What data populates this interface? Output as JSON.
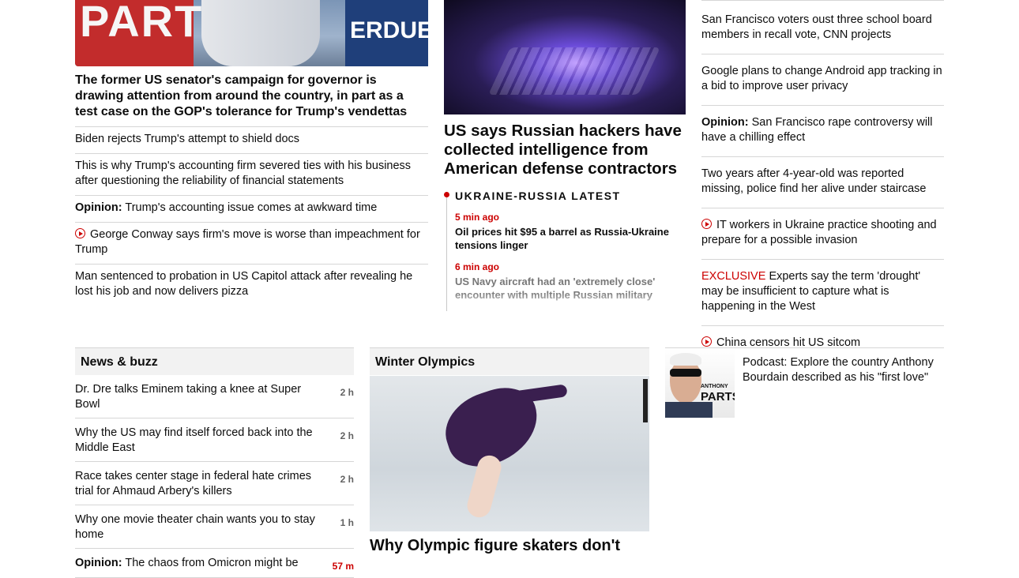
{
  "col1": {
    "photo_banner_left": "PART",
    "photo_banner_right": "ERDUE",
    "feature_headline": "The former US senator's campaign for governor is drawing attention from around the country, in part as a test case on the GOP's tolerance for Trump's vendettas",
    "links": [
      {
        "text": "Biden rejects Trump's attempt to shield docs"
      },
      {
        "text": "This is why Trump's accounting firm severed ties with his business after questioning the reliability of financial statements"
      },
      {
        "label": "Opinion:",
        "text": "Trump's accounting issue comes at awkward time"
      },
      {
        "video": true,
        "text": "George Conway says firm's move is worse than impeachment for Trump"
      },
      {
        "text": "Man sentenced to probation in US Capitol attack after revealing he lost his job and now delivers pizza"
      }
    ]
  },
  "col2": {
    "headline": "US says Russian hackers have collected intelligence from American defense contractors",
    "live_title": "UKRAINE-RUSSIA LATEST",
    "updates": [
      {
        "time": "5 min ago",
        "text": "Oil prices hit $95 a barrel as Russia-Ukraine tensions linger"
      },
      {
        "time": "6 min ago",
        "text": "US Navy aircraft had an 'extremely close' encounter with multiple Russian military"
      }
    ]
  },
  "col3": {
    "links": [
      {
        "text": "San Francisco voters oust three school board members in recall vote, CNN projects"
      },
      {
        "text": "Google plans to change Android app tracking in a bid to improve user privacy"
      },
      {
        "label": "Opinion:",
        "text": "San Francisco rape controversy will have a chilling effect"
      },
      {
        "text": "Two years after 4-year-old was reported missing, police find her alive under staircase"
      },
      {
        "video": true,
        "text": "IT workers in Ukraine practice shooting and prepare for a possible invasion"
      },
      {
        "tag": "EXCLUSIVE",
        "text": "Experts say the term 'drought' may be insufficient to capture what is happening in the West"
      },
      {
        "video": true,
        "text": "China censors hit US sitcom"
      }
    ]
  },
  "news_buzz": {
    "title": "News & buzz",
    "items": [
      {
        "text": "Dr. Dre talks Eminem taking a knee at Super Bowl",
        "age": "2 h"
      },
      {
        "text": "Why the US may find itself forced back into the Middle East",
        "age": "2 h"
      },
      {
        "text": "Race takes center stage in federal hate crimes trial for Ahmaud Arbery's killers",
        "age": "2 h"
      },
      {
        "text": "Why one movie theater chain wants you to stay home",
        "age": "1 h"
      },
      {
        "label": "Opinion:",
        "text": "The chaos from Omicron might be",
        "age": "57 m"
      }
    ]
  },
  "olympics": {
    "title": "Winter Olympics",
    "headline": "Why Olympic figure skaters don't"
  },
  "podcast": {
    "photo_brand_small": "ANTHONY",
    "photo_brand_large": "PARTS",
    "text": "Podcast: Explore the country Anthony Bourdain described as his \"first love\""
  },
  "colors": {
    "accent_red": "#cc0000",
    "rule_gray": "#d6d6d6",
    "header_bg": "#f2f2f2"
  }
}
